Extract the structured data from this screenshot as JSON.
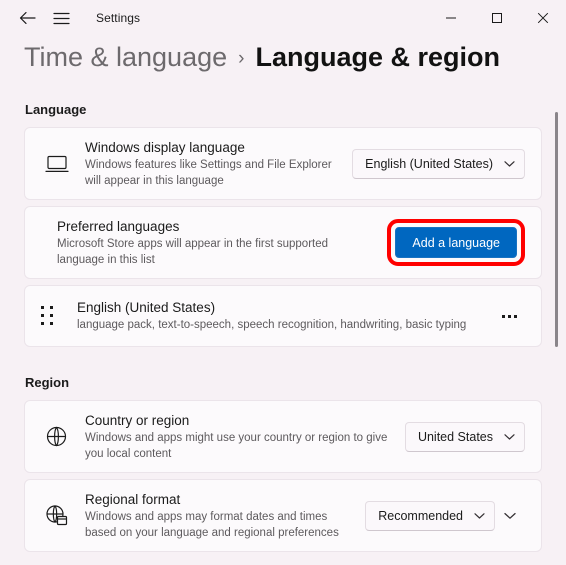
{
  "window": {
    "app_title": "Settings",
    "back_icon": "back-arrow-icon",
    "menu_icon": "hamburger-menu-icon",
    "minimize_label": "Minimize",
    "maximize_label": "Maximize",
    "close_label": "Close"
  },
  "breadcrumb": {
    "parent": "Time & language",
    "separator": "›",
    "current": "Language & region"
  },
  "sections": [
    {
      "title": "Language",
      "cards": [
        {
          "icon": "monitor-icon",
          "title": "Windows display language",
          "subtitle": "Windows features like Settings and File Explorer will appear in this language",
          "control": {
            "type": "combobox",
            "value": "English (United States)"
          }
        },
        {
          "icon": "none",
          "title": "Preferred languages",
          "subtitle": "Microsoft Store apps will appear in the first supported language in this list",
          "control": {
            "type": "accent-button",
            "label": "Add a language",
            "highlighted": true
          }
        },
        {
          "icon": "drag-handle-icon",
          "title": "English (United States)",
          "subtitle": "language pack, text-to-speech, speech recognition, handwriting, basic typing",
          "control": {
            "type": "more-button",
            "label": "…"
          }
        }
      ]
    },
    {
      "title": "Region",
      "cards": [
        {
          "icon": "globe-icon",
          "title": "Country or region",
          "subtitle": "Windows and apps might use your country or region to give you local content",
          "control": {
            "type": "combobox",
            "value": "United States"
          }
        },
        {
          "icon": "globe-clock-icon",
          "title": "Regional format",
          "subtitle": "Windows and apps may format dates and times based on your language and regional preferences",
          "control": {
            "type": "combobox",
            "value": "Recommended"
          },
          "expander": true
        }
      ]
    }
  ],
  "colors": {
    "accent_blue": "#0067C0",
    "highlight_red": "#FF0000",
    "page_background": "#F7F1F5",
    "card_background": "#FCFAFC"
  },
  "scrollbar": {
    "visible": true
  }
}
